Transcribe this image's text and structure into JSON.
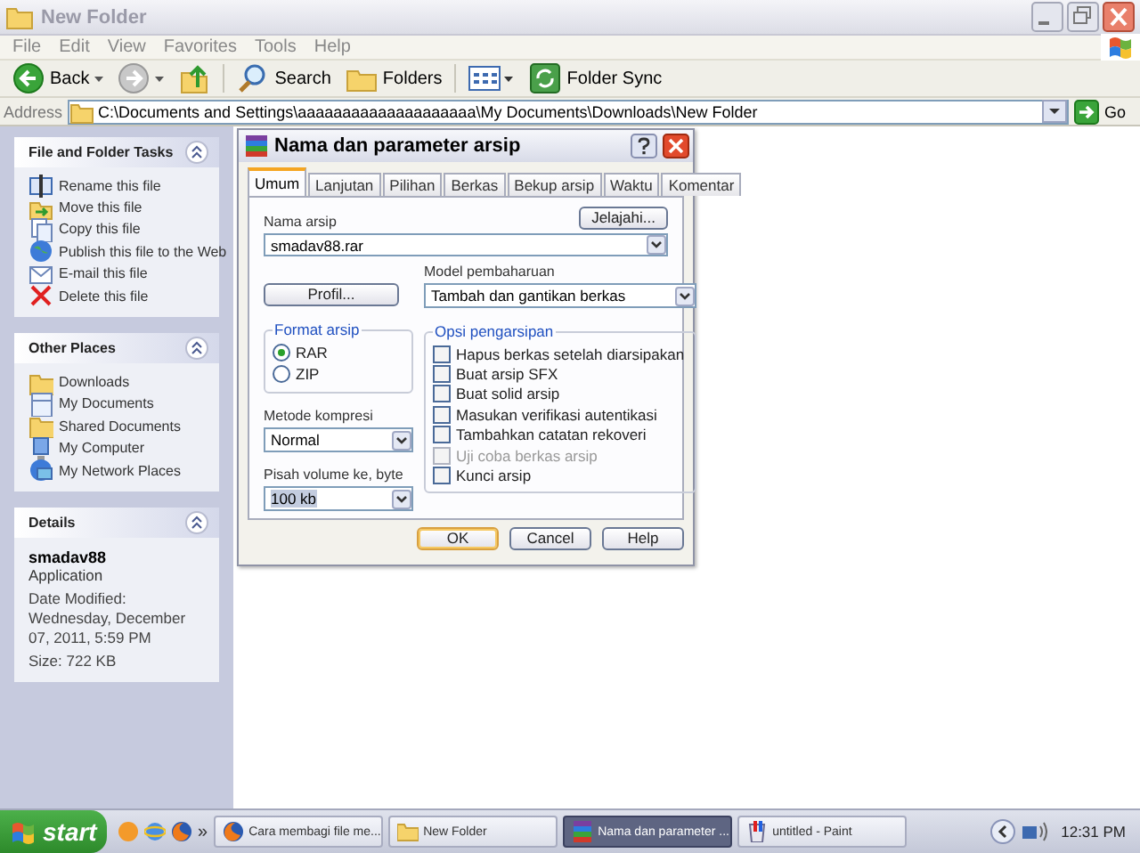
{
  "window": {
    "title": "New Folder"
  },
  "menu": [
    "File",
    "Edit",
    "View",
    "Favorites",
    "Tools",
    "Help"
  ],
  "toolbar": [
    {
      "kind": "back",
      "label": "Back"
    },
    {
      "kind": "forward"
    },
    {
      "kind": "up"
    },
    {
      "kind": "search",
      "label": "Search"
    },
    {
      "kind": "folders",
      "label": "Folders"
    },
    {
      "kind": "views"
    },
    {
      "kind": "sync",
      "label": "Folder Sync"
    }
  ],
  "address": {
    "label": "Address",
    "value": "C:\\Documents and Settings\\aaaaaaaaaaaaaaaaaaaa\\My Documents\\Downloads\\New Folder",
    "go": "Go"
  },
  "sidebar": [
    {
      "kind": "links",
      "title": "File and Folder Tasks",
      "items": [
        "Rename this file",
        "Move this file",
        "Copy this file",
        "Publish this file to the Web",
        "E-mail this file",
        "Delete this file"
      ]
    },
    {
      "kind": "links",
      "title": "Other Places",
      "items": [
        "Downloads",
        "My Documents",
        "Shared Documents",
        "My Computer",
        "My Network Places"
      ]
    },
    {
      "kind": "details",
      "title": "Details",
      "name": "smadav88",
      "type": "Application",
      "modified": "Date Modified: Wednesday, December 07, 2011, 5:59 PM",
      "size": "Size: 722 KB"
    }
  ],
  "dialog": {
    "title": "Nama dan parameter arsip",
    "tabs": [
      {
        "label": "Umum",
        "selected": true
      },
      {
        "label": "Lanjutan",
        "selected": false
      },
      {
        "label": "Pilihan",
        "selected": false
      },
      {
        "label": "Berkas",
        "selected": false
      },
      {
        "label": "Bekup arsip",
        "selected": false
      },
      {
        "label": "Waktu",
        "selected": false
      },
      {
        "label": "Komentar",
        "selected": false
      }
    ],
    "archive_name_label": "Nama arsip",
    "browse": "Jelajahi...",
    "archive_name": "smadav88.rar",
    "profile": "Profil...",
    "update_label": "Model pembaharuan",
    "update_mode": "Tambah dan gantikan berkas",
    "format": {
      "title": "Format arsip",
      "options": [
        {
          "label": "RAR",
          "selected": true
        },
        {
          "label": "ZIP",
          "selected": false
        }
      ]
    },
    "compression_label": "Metode kompresi",
    "compression": "Normal",
    "split_label": "Pisah volume ke, byte",
    "split": "100 kb",
    "options": {
      "title": "Opsi pengarsipan",
      "items": [
        {
          "label": "Hapus berkas setelah diarsipakan",
          "checked": false,
          "disabled": false
        },
        {
          "label": "Buat arsip SFX",
          "checked": false,
          "disabled": false
        },
        {
          "label": "Buat solid arsip",
          "checked": false,
          "disabled": false
        },
        {
          "label": "Masukan verifikasi autentikasi",
          "checked": false,
          "disabled": false
        },
        {
          "label": "Tambahkan catatan rekoveri",
          "checked": false,
          "disabled": false
        },
        {
          "label": "Uji coba berkas arsip",
          "checked": false,
          "disabled": true
        },
        {
          "label": "Kunci arsip",
          "checked": false,
          "disabled": false
        }
      ]
    },
    "buttons": [
      {
        "label": "OK",
        "default": true
      },
      {
        "label": "Cancel",
        "default": false
      },
      {
        "label": "Help",
        "default": false
      }
    ]
  },
  "taskbar": {
    "start": "start",
    "more": "»",
    "tasks": [
      {
        "kind": "browser",
        "label": "Cara membagi file me...",
        "selected": false
      },
      {
        "kind": "folder",
        "label": "New Folder",
        "selected": false
      },
      {
        "kind": "archive",
        "label": "Nama dan parameter ...",
        "selected": true
      },
      {
        "kind": "paint",
        "label": "untitled - Paint",
        "selected": false
      }
    ],
    "clock": "12:31 PM"
  }
}
